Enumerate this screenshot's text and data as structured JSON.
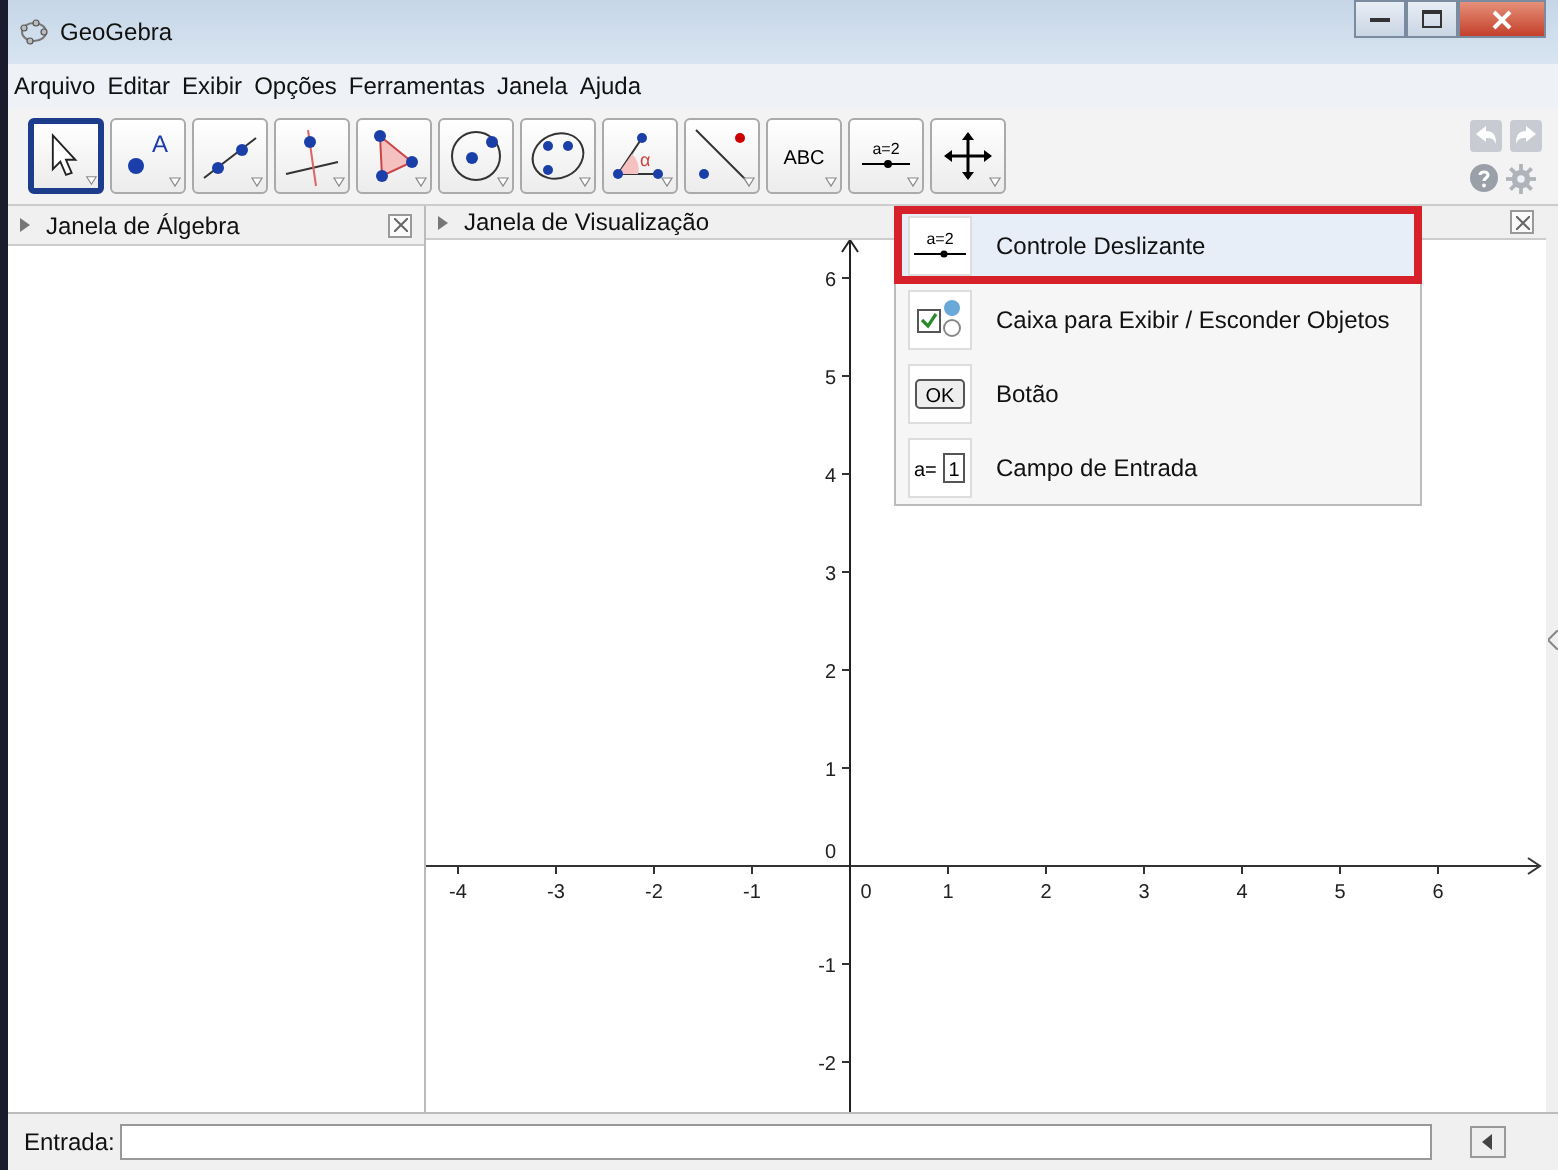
{
  "window": {
    "title": "GeoGebra"
  },
  "menu": [
    "Arquivo",
    "Editar",
    "Exibir",
    "Opções",
    "Ferramentas",
    "Janela",
    "Ajuda"
  ],
  "tools": [
    {
      "kind": "pointer",
      "selected": true
    },
    {
      "kind": "point",
      "selected": false,
      "text": "A"
    },
    {
      "kind": "line",
      "selected": false
    },
    {
      "kind": "perpendicular",
      "selected": false
    },
    {
      "kind": "polygon",
      "selected": false
    },
    {
      "kind": "circle",
      "selected": false
    },
    {
      "kind": "ellipse",
      "selected": false
    },
    {
      "kind": "angle",
      "selected": false,
      "text": "α"
    },
    {
      "kind": "reflect",
      "selected": false
    },
    {
      "kind": "text",
      "selected": false,
      "text": "ABC"
    },
    {
      "kind": "slider",
      "selected": false,
      "text": "a=2"
    },
    {
      "kind": "move",
      "selected": false
    }
  ],
  "panels": [
    {
      "title": "Janela de Álgebra"
    },
    {
      "title": "Janela de Visualização"
    }
  ],
  "graphics": {
    "x_labels": [
      "-4",
      "-3",
      "-2",
      "-1",
      "0",
      "1",
      "2",
      "3",
      "4",
      "5",
      "6"
    ],
    "y_labels": [
      "6",
      "5",
      "4",
      "3",
      "2",
      "1",
      "0",
      "-1",
      "-2"
    ]
  },
  "dropdown": [
    {
      "kind": "slider",
      "icon_text": "a=2",
      "label": "Controle Deslizante",
      "selected": true
    },
    {
      "kind": "checkbox",
      "label": "Caixa para Exibir / Esconder Objetos",
      "selected": false
    },
    {
      "kind": "button",
      "icon_text": "OK",
      "label": "Botão",
      "selected": false
    },
    {
      "kind": "input",
      "icon_text": "a=",
      "icon_value": "1",
      "label": "Campo de Entrada",
      "selected": false
    }
  ],
  "input_bar": {
    "label": "Entrada:"
  }
}
